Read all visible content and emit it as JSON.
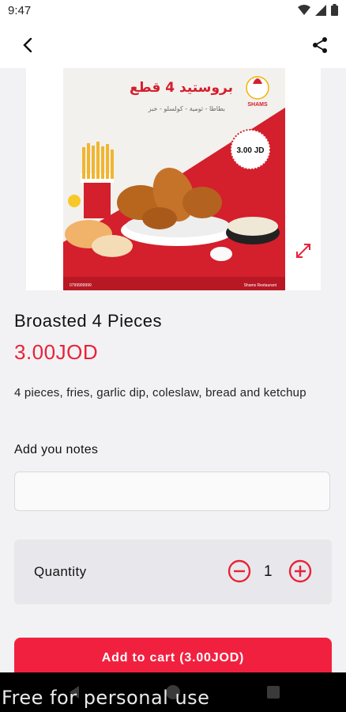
{
  "status_bar": {
    "time": "9:47"
  },
  "product": {
    "name": "Broasted 4 Pieces",
    "price": "3.00JOD",
    "description": "4 pieces, fries, garlic dip, coleslaw, bread and ketchup",
    "image": {
      "headline": "بروستيد 4 قطع",
      "subline": "بطاطا - ثومية - كولسلو - خبز",
      "price_badge": "3.00 JD",
      "brand": "SHAMS",
      "footer_left": "0799999999",
      "footer_right": "Shams Restaurant"
    }
  },
  "notes": {
    "label": "Add you notes",
    "value": "",
    "placeholder": ""
  },
  "quantity": {
    "label": "Quantity",
    "value": "1"
  },
  "cart_button": {
    "label": "Add to cart (3.00JOD)"
  },
  "watermark": "Free for personal use",
  "colors": {
    "accent": "#f2203f",
    "price": "#e8233a",
    "background": "#f2f2f4"
  }
}
